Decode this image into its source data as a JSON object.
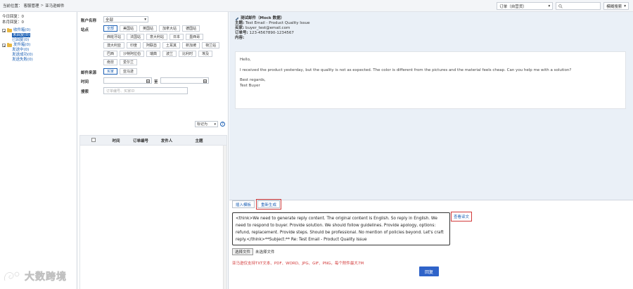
{
  "breadcrumb": {
    "label": "当前位置：",
    "items": [
      "客服管理",
      "亚马逊邮件"
    ],
    "separator": ">"
  },
  "toolbar": {
    "order_select": "订单（自营货）",
    "search_placeholder": "",
    "fuzzy_search": "模糊搜索"
  },
  "sidebar": {
    "stats": [
      "今日回复：0",
      "本月回复：0"
    ],
    "groups": [
      {
        "label": "收件箱(0)",
        "items": [
          "未回复(0)",
          "已回复(0)"
        ]
      },
      {
        "label": "发件箱(0)",
        "items": [
          "发送中(0)",
          "发送成功(0)",
          "发送失败(0)"
        ]
      }
    ]
  },
  "filters": {
    "account_label": "账户名称",
    "account_value": "全部",
    "site_label": "站点",
    "sites": [
      "全部",
      "美国站",
      "英国站",
      "加拿大站",
      "德国站",
      "西班牙站",
      "法国站",
      "意大利站",
      "日本",
      "墨西哥",
      "澳大利亚",
      "印度",
      "阿联酋",
      "土耳其",
      "新加坡",
      "荷兰站",
      "巴西",
      "沙特阿拉伯",
      "瑞典",
      "波兰",
      "比利时",
      "埃及",
      "南非",
      "爱尔兰"
    ],
    "source_label": "邮件来源",
    "sources": [
      "买家",
      "亚马逊"
    ],
    "time_label": "时间",
    "to_label": "至",
    "search_label": "搜索",
    "search_placeholder": "订单编号、买家ID",
    "mark_as": "标记为"
  },
  "table": {
    "headers": [
      "",
      "时间",
      "订单编号",
      "发件人",
      "主题"
    ]
  },
  "email": {
    "title": "测试邮件（Mock 数据）",
    "subject_label": "主题:",
    "subject": "Test Email - Product Quality Issue",
    "buyer_label": "买家:",
    "buyer": "buyer_test@email.com",
    "order_label": "订单号:",
    "order": "123-4567890-1234567",
    "content_label": "内容:",
    "greeting": "Hello,",
    "body": "I received the product yesterday, but the quality is not as expected. The color is different from the pictures and the material feels cheap. Can you help me with a solution?",
    "sign1": "Best regards,",
    "sign2": "Test Buyer"
  },
  "reply": {
    "insert_template": "插入模板",
    "regenerate": "重新生成",
    "content": "<think>We need to generate reply content. The original content is English. So reply in English. We need to respond to buyer. Provide solution. We should follow guidelines. Provide apology, options: refund, replacement. Provide steps. Should be professional. No mention of policies beyond. Let's craft reply.</think>**Subject:** Re: Test Email - Product Quality Issue",
    "view_translation": "查看译文",
    "choose_file": "选择文件",
    "no_file": "未选择文件",
    "hint": "亚马逊仅支持TXT文本、PDF、WORD、JPG、GIF、PNG，每个附件最大7M",
    "submit": "回复"
  },
  "watermark": {
    "text": "大数跨境"
  },
  "colors": {
    "accent": "#1a5fb4",
    "primary_button": "#2f63c9",
    "highlight_red": "#d23a3a",
    "email_panel_bg": "#eaf0f7"
  }
}
